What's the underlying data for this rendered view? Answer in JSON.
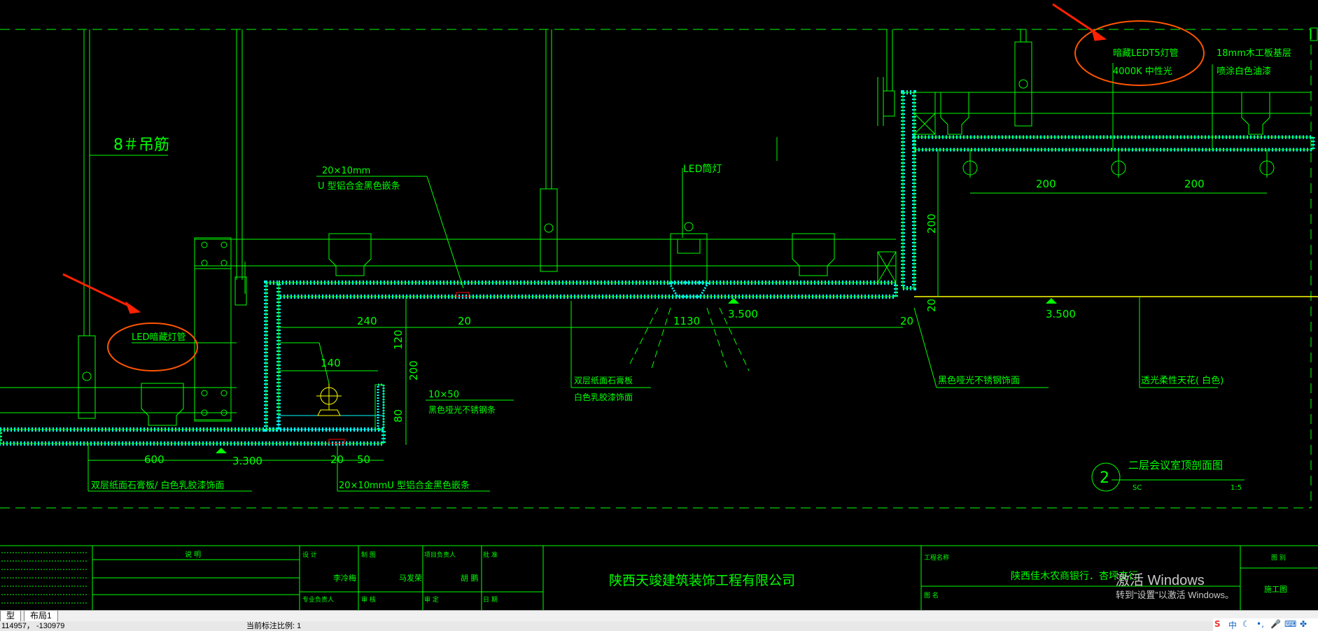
{
  "drawing": {
    "labels": {
      "hanger": "8＃吊筋",
      "u_profile_size": "20×10mm",
      "u_profile_desc": "U 型铝合金黑色嵌条",
      "led_downlight": "LED筒灯",
      "hidden_t5": "暗藏LEDT5灯管",
      "hidden_t5_color": "4000K 中性光",
      "plywood": "18mm木工板基层",
      "white_paint": "喷涂白色油漆",
      "led_strip": "LED暗藏灯管",
      "steel_size": "10×50",
      "steel_desc": "黑色哑光不锈钢条",
      "gypsum_left": "双层纸面石膏板/ 白色乳胶漆饰面",
      "gypsum_mid_1": "双层纸面石膏板",
      "gypsum_mid_2": "白色乳胶漆饰面",
      "steel_trim": "黑色哑光不锈钢饰面",
      "soft_film": "透光柔性天花( 白色)",
      "u_profile_bottom": "20×10mmU 型铝合金黑色嵌条",
      "section_title": "二层会议室顶剖面图",
      "section_no": "2",
      "section_sub": "SC",
      "section_scale": "1:5"
    },
    "dims": {
      "d240": "240",
      "d20a": "20",
      "d1130": "1130",
      "d20b": "20",
      "d140": "140",
      "d120": "120",
      "d200v": "200",
      "d80": "80",
      "d600": "600",
      "d20c": "20",
      "d50": "50",
      "d200a": "200",
      "d200b": "200",
      "d200r": "200",
      "d20r": "20",
      "el_3500a": "3.500",
      "el_3500b": "3.500",
      "el_3300": "3.300"
    },
    "title_block": {
      "notes_header": "说 明",
      "drawer": "设 计",
      "drawer_name": "李冷梅",
      "checker": "制 图",
      "checker_name": "马发荣",
      "reviewer": "项目负责人",
      "reviewer_name": "胡 鹏",
      "approver": "批 准",
      "approver_name": "",
      "date_label": "日 期",
      "project_lead": "专业负责人",
      "review": "审 核",
      "audit": "审 定",
      "company": "陕西天竣建筑装饰工程有限公司",
      "project_label": "工程名称",
      "project_name": "陕西佳木农商银行．杏坪支行",
      "drawing_name_label": "图 名",
      "stage_label": "图 别",
      "stage": "施工图"
    }
  },
  "tabs": [
    {
      "label": "型"
    },
    {
      "label": "布局1"
    }
  ],
  "status": {
    "coords": "114957， -130979",
    "annotation_scale": "当前标注比例: 1"
  },
  "watermark": {
    "title": "激活 Windows",
    "subtitle": "转到“设置”以激活 Windows。"
  },
  "tray": {
    "ime": "中"
  },
  "colors": {
    "line": "#00ff00",
    "fill": "#00ffff",
    "marker": "#ff0000",
    "annotation": "#ff5500",
    "yellow": "#ffff00"
  }
}
